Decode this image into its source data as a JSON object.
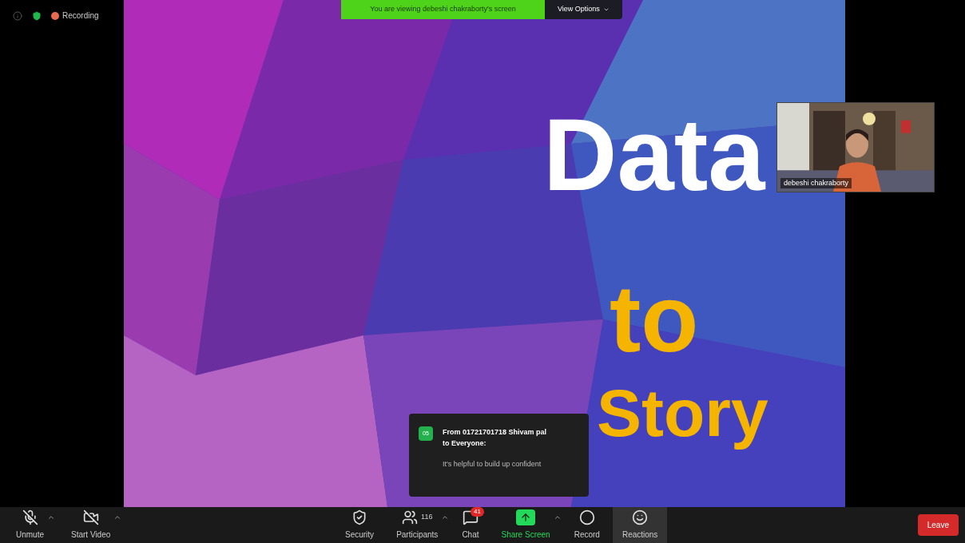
{
  "status": {
    "recording_label": "Recording"
  },
  "share_banner": {
    "text": "You are viewing debeshi chakraborty's screen",
    "view_options": "View Options"
  },
  "slide": {
    "words": [
      {
        "text": "Data",
        "color": "#ffffff"
      },
      {
        "text": "to",
        "color": "#f5b400"
      },
      {
        "text": "Story",
        "color": "#f5b400"
      }
    ]
  },
  "video_tile": {
    "kind": "picture",
    "name": "debeshi chakraborty"
  },
  "chat_notification": {
    "avatar": "05",
    "sender": "From 01721701718 Shivam pal to Everyone:",
    "message": "It's helpful to build up confident"
  },
  "toolbar": {
    "left": [
      {
        "kind": "mic",
        "label": "Unmute",
        "caret": true
      },
      {
        "kind": "video",
        "label": "Start Video",
        "caret": true
      }
    ],
    "center": [
      {
        "kind": "security",
        "label": "Security",
        "caret": false,
        "selected": false
      },
      {
        "kind": "participants",
        "label": "Participants",
        "count": "116",
        "caret": true,
        "selected": false
      },
      {
        "kind": "chat",
        "label": "Chat",
        "badge": "41",
        "caret": false,
        "selected": false
      },
      {
        "kind": "share",
        "label": "Share Screen",
        "caret": true,
        "selected": false
      },
      {
        "kind": "record",
        "label": "Record",
        "caret": false,
        "selected": false
      },
      {
        "kind": "reactions",
        "label": "Reactions",
        "caret": false,
        "selected": true
      }
    ],
    "leave": "Leave"
  }
}
